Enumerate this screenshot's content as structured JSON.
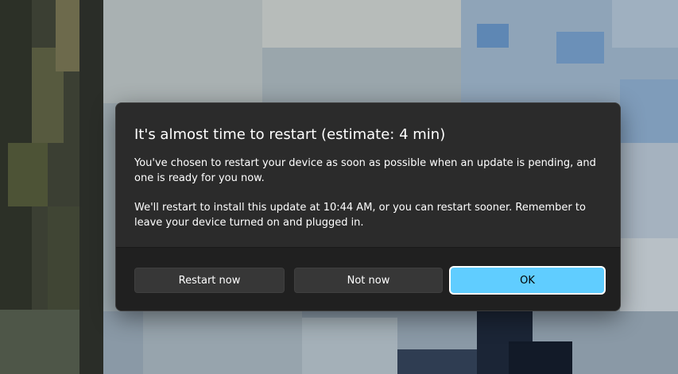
{
  "dialog": {
    "title": "It's almost time to restart (estimate: 4 min)",
    "paragraph1": "You've chosen to restart your device as soon as possible when an update is pending, and one is ready for you now.",
    "paragraph2": "We'll restart to install this update at 10:44 AM, or you can restart sooner. Remember to leave your device turned on and plugged in.",
    "buttons": {
      "restart_now": "Restart now",
      "not_now": "Not now",
      "ok": "OK"
    }
  },
  "colors": {
    "accent": "#60cdff",
    "dialog_background": "#2b2b2b",
    "footer_background": "#202020"
  }
}
